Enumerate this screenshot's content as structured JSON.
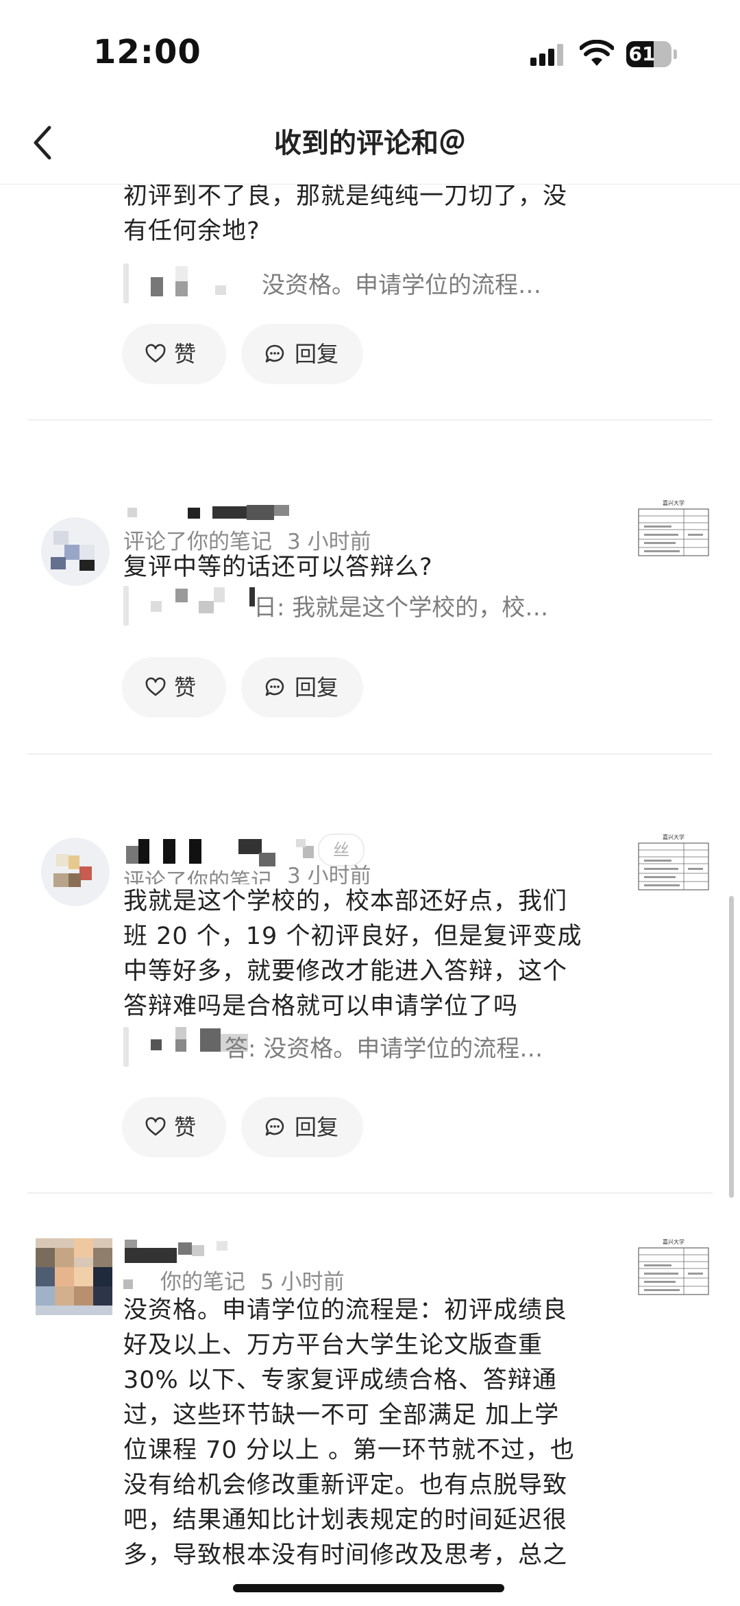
{
  "status_bar": {
    "time": "12:00",
    "battery_level": "61",
    "battery_fraction": 0.61,
    "icons": [
      "signal-icon",
      "wifi-icon",
      "battery-icon"
    ]
  },
  "nav": {
    "title": "收到的评论和＠",
    "back_icon": "chevron-left-icon"
  },
  "actions": {
    "like_label": "赞",
    "reply_label": "回复",
    "like_icon": "heart-icon",
    "reply_icon": "chat-bubble-icon"
  },
  "notifications": [
    {
      "comment_lines": [
        "初评到不了良，那就是纯纯一刀切了，没",
        "有任何余地?"
      ],
      "quote": "没资格。申请学位的流程…"
    },
    {
      "meta_action": "评论了你的笔记",
      "meta_time": "3 小时前",
      "comment_lines": [
        "复评中等的话还可以答辩么?"
      ],
      "quote": "日: 我就是这个学校的，校…",
      "thumb_title": "嘉兴大学"
    },
    {
      "fan_badge": "丝",
      "meta_action": "评论了你的笔记",
      "meta_time": "3 小时前",
      "comment_lines": [
        "我就是这个学校的，校本部还好点，我们",
        "班 20 个，19 个初评良好，但是复评变成",
        "中等好多，就要修改才能进入答辩，这个",
        "答辩难吗是合格就可以申请学位了吗"
      ],
      "quote": "答: 没资格。申请学位的流程…",
      "thumb_title": "嘉兴大学"
    },
    {
      "meta_action": "你的笔记",
      "meta_time": "5 小时前",
      "comment_lines": [
        "没资格。申请学位的流程是：初评成绩良",
        "好及以上、万方平台大学生论文版查重",
        "30% 以下、专家复评成绩合格、答辩通",
        "过，这些环节缺一不可 全部满足 加上学",
        "位课程 70 分以上 。第一环节就不过，也",
        "没有给机会修改重新评定。也有点脱导致",
        "吧，结果通知比计划表规定的时间延迟很",
        "多，导致根本没有时间修改及思考，总之"
      ],
      "thumb_title": "嘉兴大学"
    }
  ]
}
